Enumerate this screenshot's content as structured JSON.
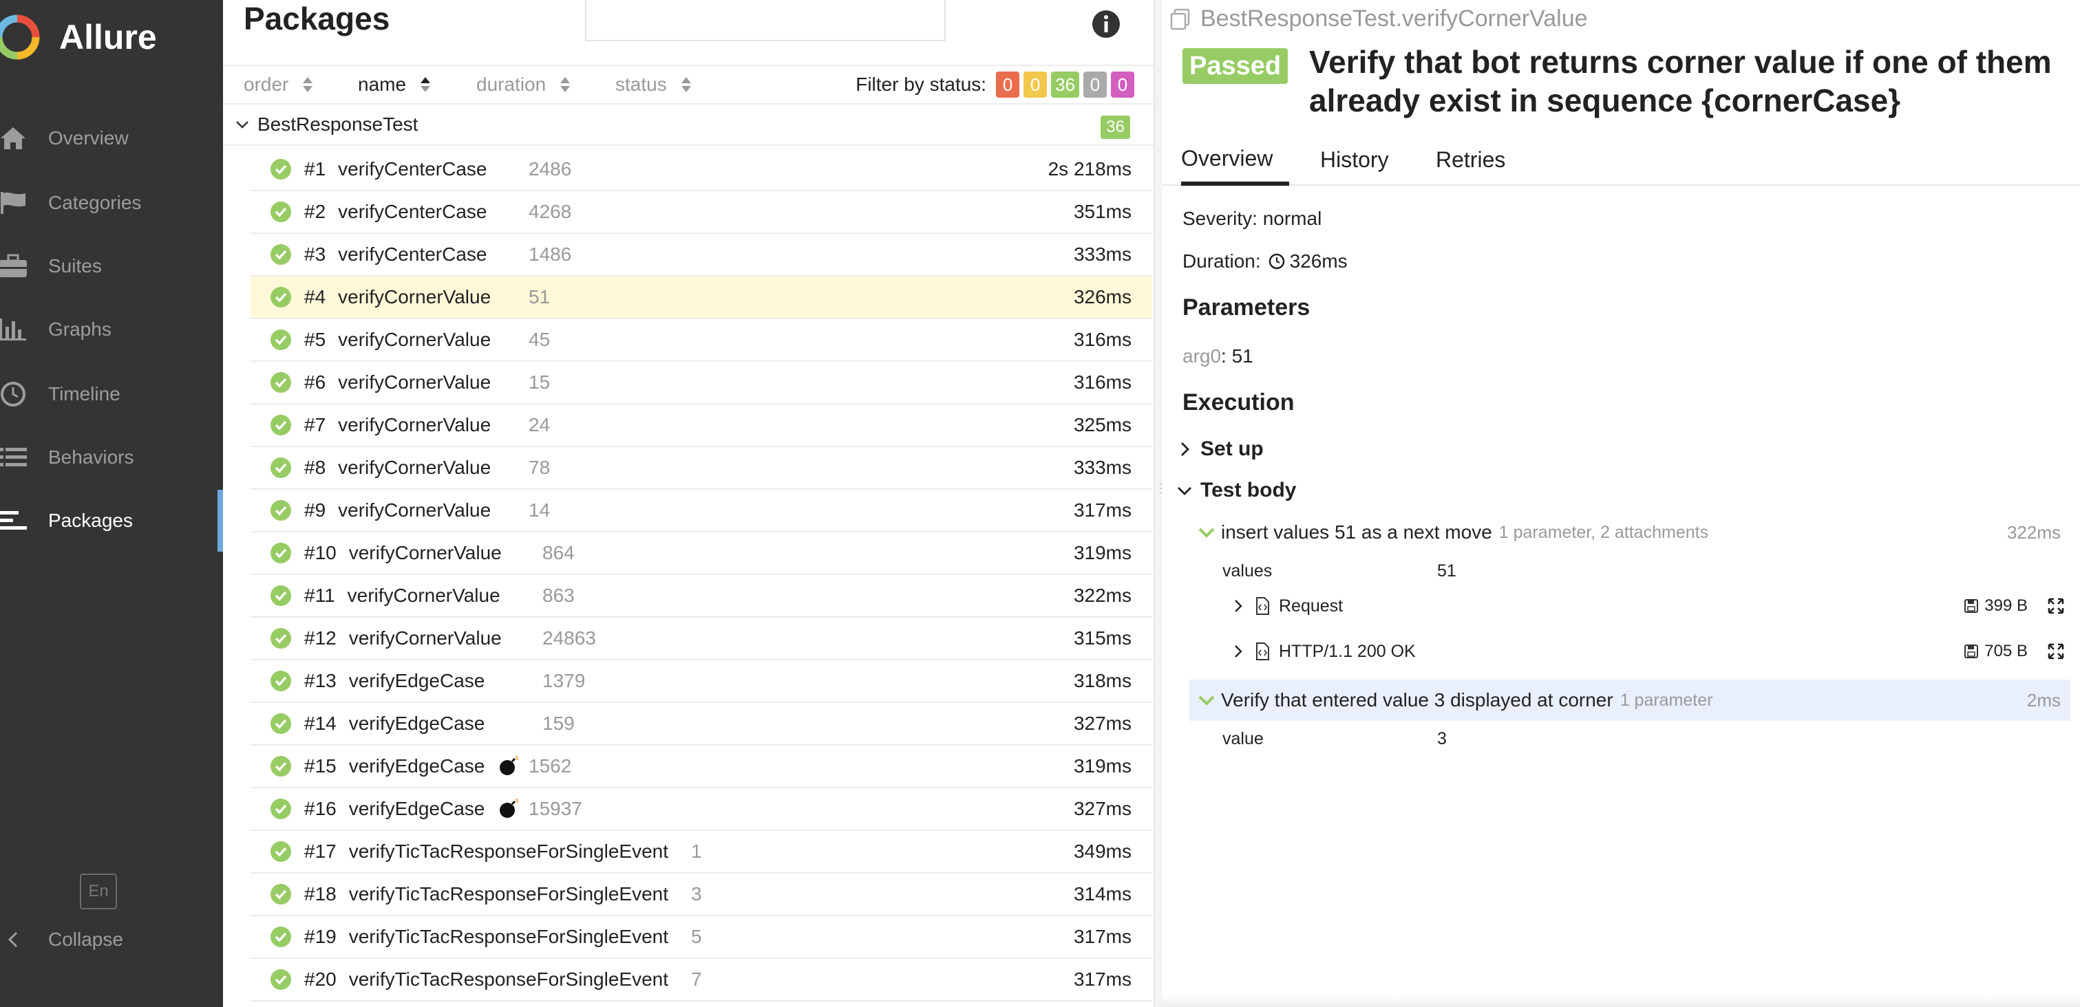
{
  "app": {
    "name": "Allure"
  },
  "sidebar": {
    "items": [
      {
        "label": "Overview",
        "icon": "home-icon"
      },
      {
        "label": "Categories",
        "icon": "flag-icon"
      },
      {
        "label": "Suites",
        "icon": "briefcase-icon"
      },
      {
        "label": "Graphs",
        "icon": "bar-chart-icon"
      },
      {
        "label": "Timeline",
        "icon": "clock-icon"
      },
      {
        "label": "Behaviors",
        "icon": "list-icon"
      },
      {
        "label": "Packages",
        "icon": "align-left-icon",
        "active": true
      }
    ],
    "language": "En",
    "collapse_label": "Collapse"
  },
  "packages": {
    "title": "Packages",
    "search": {
      "value": "",
      "placeholder": ""
    },
    "sort": {
      "columns": [
        "order",
        "name",
        "duration",
        "status"
      ],
      "active": "name"
    },
    "filter": {
      "label": "Filter by status:",
      "counts": [
        {
          "status": "failed",
          "value": "0",
          "color": "#ea6d4d"
        },
        {
          "status": "broken",
          "value": "0",
          "color": "#f2c84b"
        },
        {
          "status": "passed",
          "value": "36",
          "color": "#97cc64"
        },
        {
          "status": "skipped",
          "value": "0",
          "color": "#aaaaaa"
        },
        {
          "status": "unknown",
          "value": "0",
          "color": "#d35ebe"
        }
      ]
    },
    "group": {
      "name": "BestResponseTest",
      "count": "36"
    },
    "rows": [
      {
        "num": "#1",
        "name": "verifyCenterCase",
        "param": "2486",
        "duration": "2s 218ms"
      },
      {
        "num": "#2",
        "name": "verifyCenterCase",
        "param": "4268",
        "duration": "351ms"
      },
      {
        "num": "#3",
        "name": "verifyCenterCase",
        "param": "1486",
        "duration": "333ms"
      },
      {
        "num": "#4",
        "name": "verifyCornerValue",
        "param": "51",
        "duration": "326ms",
        "selected": true
      },
      {
        "num": "#5",
        "name": "verifyCornerValue",
        "param": "45",
        "duration": "316ms"
      },
      {
        "num": "#6",
        "name": "verifyCornerValue",
        "param": "15",
        "duration": "316ms"
      },
      {
        "num": "#7",
        "name": "verifyCornerValue",
        "param": "24",
        "duration": "325ms"
      },
      {
        "num": "#8",
        "name": "verifyCornerValue",
        "param": "78",
        "duration": "333ms"
      },
      {
        "num": "#9",
        "name": "verifyCornerValue",
        "param": "14",
        "duration": "317ms"
      },
      {
        "num": "#10",
        "name": "verifyCornerValue",
        "param": "864",
        "duration": "319ms"
      },
      {
        "num": "#11",
        "name": "verifyCornerValue",
        "param": "863",
        "duration": "322ms"
      },
      {
        "num": "#12",
        "name": "verifyCornerValue",
        "param": "24863",
        "duration": "315ms"
      },
      {
        "num": "#13",
        "name": "verifyEdgeCase",
        "param": "1379",
        "duration": "318ms"
      },
      {
        "num": "#14",
        "name": "verifyEdgeCase",
        "param": "159",
        "duration": "327ms"
      },
      {
        "num": "#15",
        "name": "verifyEdgeCase",
        "param": "1562",
        "duration": "319ms",
        "bomb": true
      },
      {
        "num": "#16",
        "name": "verifyEdgeCase",
        "param": "15937",
        "duration": "327ms",
        "bomb": true
      },
      {
        "num": "#17",
        "name": "verifyTicTacResponseForSingleEvent",
        "param": "1",
        "duration": "349ms"
      },
      {
        "num": "#18",
        "name": "verifyTicTacResponseForSingleEvent",
        "param": "3",
        "duration": "314ms"
      },
      {
        "num": "#19",
        "name": "verifyTicTacResponseForSingleEvent",
        "param": "5",
        "duration": "317ms"
      },
      {
        "num": "#20",
        "name": "verifyTicTacResponseForSingleEvent",
        "param": "7",
        "duration": "317ms"
      }
    ]
  },
  "detail": {
    "breadcrumb": "BestResponseTest.verifyCornerValue",
    "status": "Passed",
    "title": "Verify that bot returns corner value if one of them already exist in sequence {cornerCase}",
    "tabs": [
      "Overview",
      "History",
      "Retries"
    ],
    "severity": "Severity: normal",
    "duration_label": "Duration:",
    "duration": "326ms",
    "parameters_heading": "Parameters",
    "parameter": {
      "name": "arg0",
      "value": ": 51"
    },
    "execution_heading": "Execution",
    "setup_label": "Set up",
    "body_label": "Test body",
    "steps": [
      {
        "text": "insert values 51 as a next move",
        "sub": "1 parameter, 2 attachments",
        "duration": "322ms",
        "param_name": "values",
        "param_value": "51",
        "attachments": [
          {
            "label": "Request",
            "size": "399 B"
          },
          {
            "label": "HTTP/1.1 200 OK",
            "size": "705 B"
          }
        ]
      },
      {
        "text": "Verify that entered value 3 displayed at corner",
        "sub": "1 parameter",
        "duration": "2ms",
        "param_name": "value",
        "param_value": "3"
      }
    ]
  }
}
